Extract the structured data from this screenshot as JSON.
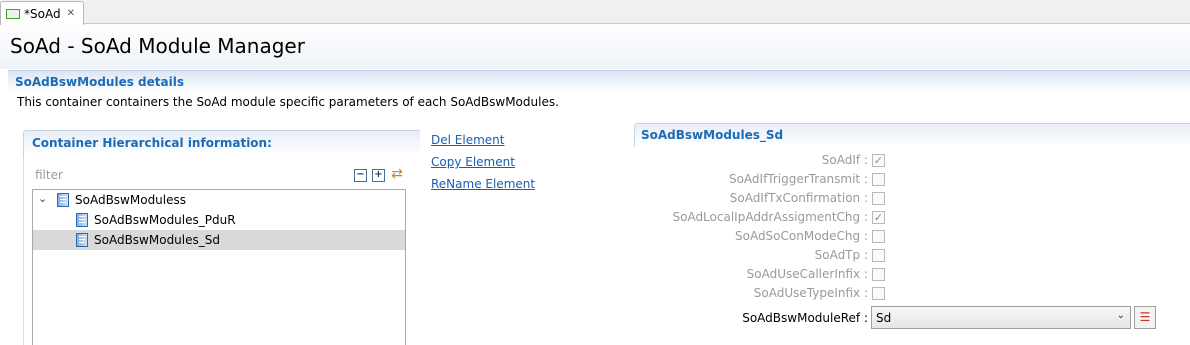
{
  "tab": {
    "label": "*SoAd",
    "close": "✕"
  },
  "header": {
    "title": "SoAd - SoAd Module Manager"
  },
  "section": {
    "title": "SoAdBswModules details",
    "description": "This container containers the SoAd module specific parameters of each SoAdBswModules."
  },
  "hierarchy": {
    "title": "Container Hierarchical information:",
    "filter_placeholder": "filter",
    "tools": {
      "collapse": "−",
      "expand": "+",
      "sync": "⇄"
    },
    "tree": {
      "arrow": "⌄",
      "root": "SoAdBswModuless",
      "children": [
        "SoAdBswModules_PduR",
        "SoAdBswModules_Sd"
      ],
      "selected_index": 1
    }
  },
  "actions": {
    "delete": "Del Element",
    "copy": "Copy Element",
    "rename": "ReName Element"
  },
  "details": {
    "title": "SoAdBswModules_Sd",
    "params": [
      {
        "label": "SoAdIf :",
        "checked": true,
        "mark": "✓"
      },
      {
        "label": "SoAdIfTriggerTransmit :",
        "checked": false,
        "mark": ""
      },
      {
        "label": "SoAdIfTxConfirmation :",
        "checked": false,
        "mark": ""
      },
      {
        "label": "SoAdLocalIpAddrAssigmentChg :",
        "checked": true,
        "mark": "✓"
      },
      {
        "label": "SoAdSoConModeChg :",
        "checked": false,
        "mark": ""
      },
      {
        "label": "SoAdTp :",
        "checked": false,
        "mark": ""
      },
      {
        "label": "SoAdUseCallerInfix :",
        "checked": false,
        "mark": ""
      },
      {
        "label": "SoAdUseTypeInfix :",
        "checked": false,
        "mark": ""
      }
    ],
    "module_ref": {
      "label": "SoAdBswModuleRef :",
      "value": "Sd",
      "chevron": "⌄",
      "list_icon": "☰"
    }
  }
}
